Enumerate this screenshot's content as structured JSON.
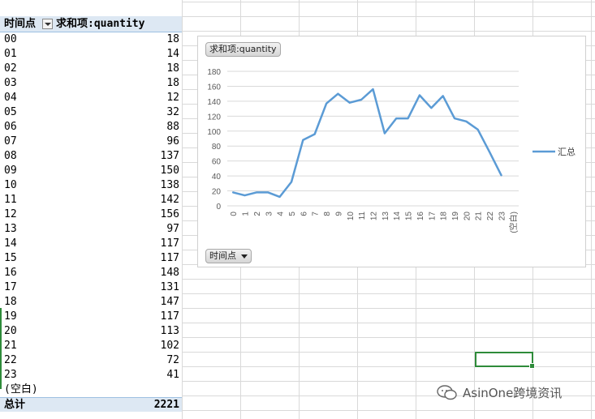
{
  "pivot": {
    "header_row_label": "时间点",
    "header_value_label": "求和项:quantity",
    "rows": [
      {
        "label": "00",
        "value": "18"
      },
      {
        "label": "01",
        "value": "14"
      },
      {
        "label": "02",
        "value": "18"
      },
      {
        "label": "03",
        "value": "18"
      },
      {
        "label": "04",
        "value": "12"
      },
      {
        "label": "05",
        "value": "32"
      },
      {
        "label": "06",
        "value": "88"
      },
      {
        "label": "07",
        "value": "96"
      },
      {
        "label": "08",
        "value": "137"
      },
      {
        "label": "09",
        "value": "150"
      },
      {
        "label": "10",
        "value": "138"
      },
      {
        "label": "11",
        "value": "142"
      },
      {
        "label": "12",
        "value": "156"
      },
      {
        "label": "13",
        "value": "97"
      },
      {
        "label": "14",
        "value": "117"
      },
      {
        "label": "15",
        "value": "117"
      },
      {
        "label": "16",
        "value": "148"
      },
      {
        "label": "17",
        "value": "131"
      },
      {
        "label": "18",
        "value": "147"
      },
      {
        "label": "19",
        "value": "117"
      },
      {
        "label": "20",
        "value": "113"
      },
      {
        "label": "21",
        "value": "102"
      },
      {
        "label": "22",
        "value": "72"
      },
      {
        "label": "23",
        "value": "41"
      },
      {
        "label": "(空白)",
        "value": ""
      }
    ],
    "total_label": "总计",
    "total_value": "2221"
  },
  "chart_field_buttons": {
    "value_field": "求和项:quantity",
    "axis_field": "时间点"
  },
  "chart_data": {
    "type": "line",
    "categories": [
      "0",
      "1",
      "2",
      "3",
      "4",
      "5",
      "6",
      "7",
      "8",
      "9",
      "10",
      "11",
      "12",
      "13",
      "14",
      "15",
      "16",
      "17",
      "18",
      "19",
      "20",
      "21",
      "22",
      "23",
      "(空白)"
    ],
    "series": [
      {
        "name": "汇总",
        "values": [
          18,
          14,
          18,
          18,
          12,
          32,
          88,
          96,
          137,
          150,
          138,
          142,
          156,
          97,
          117,
          117,
          148,
          131,
          147,
          117,
          113,
          102,
          72,
          41,
          null
        ],
        "color": "#5b9bd5"
      }
    ],
    "yticks": [
      "0",
      "20",
      "40",
      "60",
      "80",
      "100",
      "120",
      "140",
      "160",
      "180"
    ],
    "ylim": [
      0,
      180
    ],
    "grid": true,
    "legend_position": "right"
  },
  "watermark": "AsinOne跨境资讯"
}
